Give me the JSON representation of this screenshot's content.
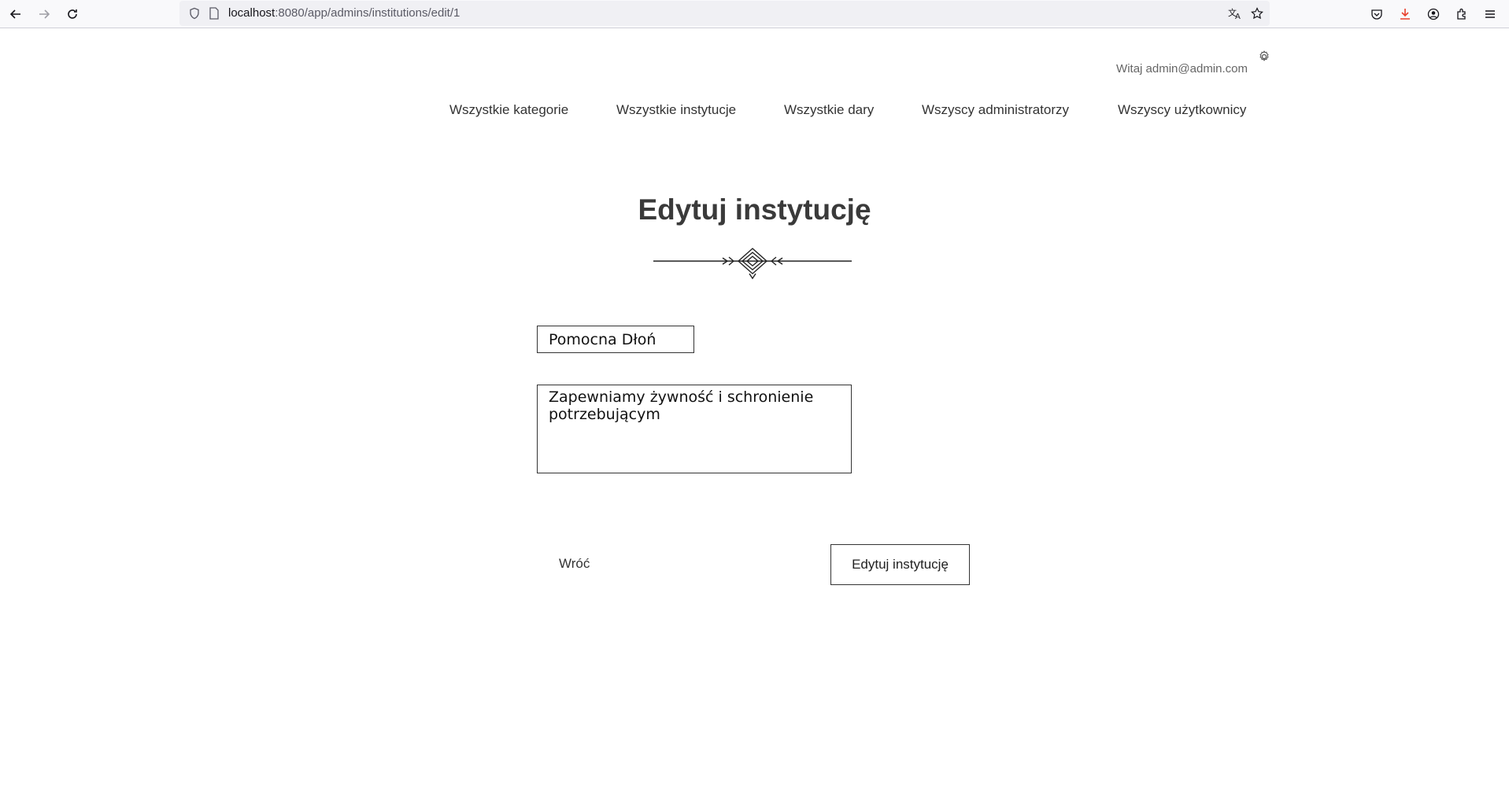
{
  "browser": {
    "url_host": "localhost",
    "url_rest": ":8080/app/admins/institutions/edit/1"
  },
  "header": {
    "greeting": "Witaj admin@admin.com"
  },
  "nav": {
    "items": [
      {
        "label": "Wszystkie kategorie"
      },
      {
        "label": "Wszystkie instytucje"
      },
      {
        "label": "Wszystkie dary"
      },
      {
        "label": "Wszyscy administratorzy"
      },
      {
        "label": "Wszyscy użytkownicy"
      }
    ]
  },
  "form": {
    "title": "Edytuj instytucję",
    "name_value": "Pomocna Dłoń",
    "description_value": "Zapewniamy żywność i schronienie potrzebującym",
    "back_label": "Wróć",
    "submit_label": "Edytuj instytucję"
  },
  "colors": {
    "download_accent": "#e8402d",
    "text": "#333333"
  }
}
